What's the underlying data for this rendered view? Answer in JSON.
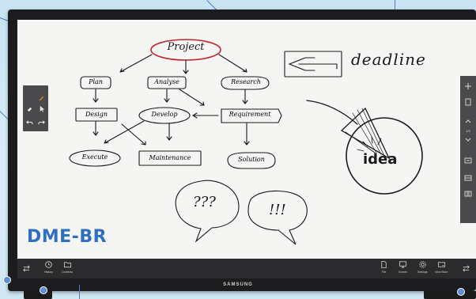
{
  "whiteboard": {
    "title_node": "Project",
    "level1": [
      "Plan",
      "Analyse",
      "Research"
    ],
    "level2": [
      "Design",
      "Develop",
      "Requirement"
    ],
    "level3": [
      "Execute",
      "Maintenance",
      "Solution"
    ],
    "deadline_note": "deadline",
    "pie_label": "idea",
    "bubble_left": "???",
    "bubble_right": "!!!"
  },
  "watermark": "DME-BR",
  "bottom_toolbar": {
    "history_label": "History",
    "contents_label": "Contents",
    "file_label": "File",
    "screen_label": "Screen",
    "settings_label": "Settings",
    "viewmore_label": "View More"
  },
  "right_toolbar": {
    "page_indicator": "1/3"
  },
  "brand": "SAMSUNG",
  "colors": {
    "pen_red": "#c0262c",
    "ink": "#1a1a1a",
    "watermark": "#2f6fbf",
    "callout_pin": "#5b8fcf"
  }
}
